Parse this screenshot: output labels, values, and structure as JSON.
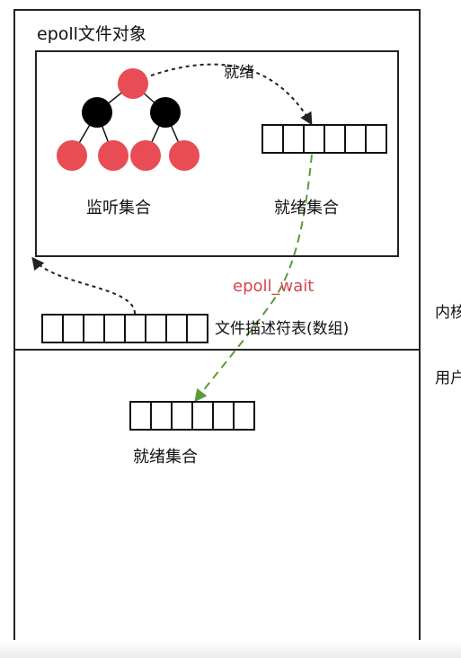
{
  "labels": {
    "epoll_object": "epoll文件对象",
    "ready_arrow": "就绪",
    "monitor_set": "监听集合",
    "ready_set_kernel": "就绪集合",
    "epoll_wait": "epoll_wait",
    "fd_table": "文件描述符表(数组)",
    "kernel_space": "内核",
    "user_space": "用户",
    "ready_set_user": "就绪集合"
  },
  "colors": {
    "tree_red_node": "#e84c55",
    "tree_black_node": "#000000",
    "epoll_wait_arrow": "#5a9c3a",
    "epoll_wait_text": "#d64550",
    "outline": "#222222"
  },
  "arrays": {
    "ready_set_kernel_cells": 6,
    "fd_table_cells": 8,
    "ready_set_user_cells": 6
  }
}
